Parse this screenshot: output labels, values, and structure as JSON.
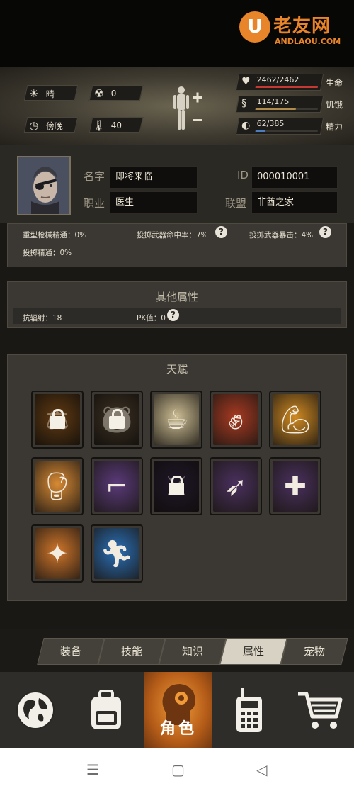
{
  "watermark": {
    "logo_letter": "U",
    "site_cn": "老友网",
    "site_en": "ANDLAOU.COM"
  },
  "environment": {
    "weather": "晴",
    "radiation": "0",
    "time_of_day": "傍晚",
    "temperature": "40"
  },
  "vitals": [
    {
      "key": "life",
      "value": "2462/2462",
      "label": "生命",
      "fraction": 1.0,
      "color": "#c43a32"
    },
    {
      "key": "hunger",
      "value": "114/175",
      "label": "饥饿",
      "fraction": 0.651,
      "color": "#b08c4c"
    },
    {
      "key": "energy",
      "value": "62/385",
      "label": "精力",
      "fraction": 0.161,
      "color": "#4a7cc0"
    }
  ],
  "profile": {
    "name_label": "名字",
    "name_value": "即将来临",
    "job_label": "职业",
    "job_value": "医生",
    "id_label": "ID",
    "id_value": "000010001",
    "alliance_label": "联盟",
    "alliance_value": "非酋之家"
  },
  "stats": {
    "heavy_firearms": "重型枪械精通：0%",
    "throw_hit": "投掷武器命中率：7%",
    "throw_crit": "投掷武器暴击：4%",
    "throw_mastery": "投掷精通：0%",
    "help_glyph": "?"
  },
  "other_attributes": {
    "title": "其他属性",
    "radiation_resist": "抗辐射：18",
    "pk_value": "PK值：0"
  },
  "talents": {
    "title": "天赋",
    "items": [
      {
        "icon": "porter-scale-icon",
        "locked": true,
        "color": "#b06a22"
      },
      {
        "icon": "bear-icon",
        "locked": true,
        "color": "#6e5a40"
      },
      {
        "icon": "drinking-figure-icon",
        "locked": false,
        "color": "#cdbe94"
      },
      {
        "icon": "fist-icon",
        "locked": false,
        "color": "#a83a22"
      },
      {
        "icon": "strongman-icon",
        "locked": false,
        "color": "#d08a22"
      },
      {
        "icon": "boxer-icon",
        "locked": false,
        "color": "#d88a34"
      },
      {
        "icon": "pistol-icon",
        "locked": false,
        "color": "#5a3a7a"
      },
      {
        "icon": "rifleman-icon",
        "locked": true,
        "color": "#3a2a4a"
      },
      {
        "icon": "archer-icon",
        "locked": false,
        "color": "#4a305e"
      },
      {
        "icon": "shield-cross-icon",
        "locked": false,
        "color": "#4a305e"
      },
      {
        "icon": "kick-icon",
        "locked": false,
        "color": "#d0762a"
      },
      {
        "icon": "crouch-runner-icon",
        "locked": false,
        "color": "#2a70b8"
      }
    ]
  },
  "tabs": [
    "装备",
    "技能",
    "知识",
    "属性",
    "宠物"
  ],
  "active_tab": "属性",
  "bottom_nav": [
    {
      "key": "world",
      "icon": "globe-icon"
    },
    {
      "key": "bag",
      "icon": "backpack-icon"
    },
    {
      "key": "character",
      "icon": "character-head-icon",
      "label": "角色"
    },
    {
      "key": "radio",
      "icon": "walkie-talkie-icon"
    },
    {
      "key": "shop",
      "icon": "cart-icon"
    }
  ],
  "system_nav": {
    "menu": "☰",
    "home": "▢",
    "back": "◁"
  }
}
